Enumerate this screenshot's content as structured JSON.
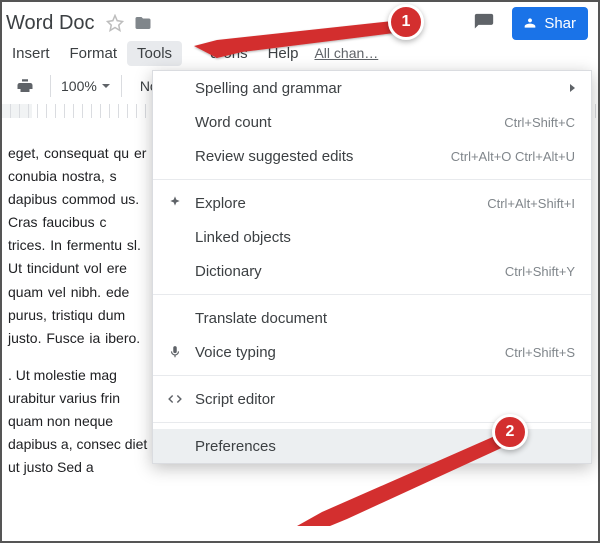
{
  "header": {
    "doc_title": "Word Doc",
    "share_label": "Shar"
  },
  "menubar": {
    "insert": "Insert",
    "format": "Format",
    "tools": "Tools",
    "addons": "d-ons",
    "help": "Help",
    "all_changes": "All chan…"
  },
  "toolbar": {
    "zoom": "100%",
    "style": "Normal"
  },
  "dropdown": {
    "spelling": "Spelling and grammar",
    "wordcount": "Word count",
    "wordcount_sc": "Ctrl+Shift+C",
    "review": "Review suggested edits",
    "review_sc": "Ctrl+Alt+O Ctrl+Alt+U",
    "explore": "Explore",
    "explore_sc": "Ctrl+Alt+Shift+I",
    "linked": "Linked objects",
    "dictionary": "Dictionary",
    "dictionary_sc": "Ctrl+Shift+Y",
    "translate": "Translate document",
    "voice": "Voice typing",
    "voice_sc": "Ctrl+Shift+S",
    "script": "Script editor",
    "prefs": "Preferences"
  },
  "doc": {
    "p1": "eget, consequat qu er conubia nostra, s dapibus commod us. Cras faucibus c trices. In fermentu sl. Ut tincidunt vol ere quam vel nibh. ede purus, tristiqu dum justo. Fusce ia ibero.",
    "p2": ". Ut molestie mag urabitur varius frin quam non neque dapibus a, consec diet ut justo Sed a"
  },
  "badges": {
    "one": "1",
    "two": "2"
  }
}
